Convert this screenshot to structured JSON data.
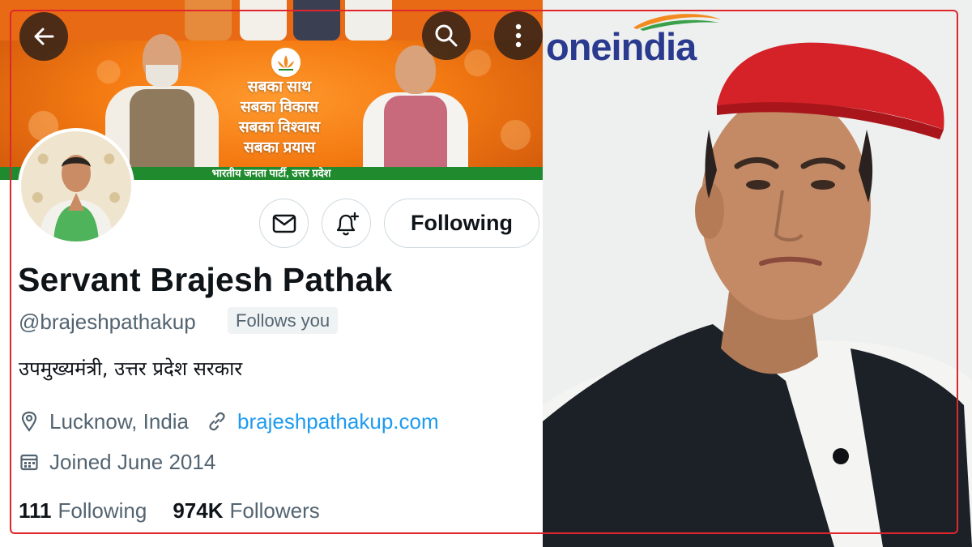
{
  "profile": {
    "banner": {
      "slogan": [
        "सबका साथ",
        "सबका विकास",
        "सबका विश्वास",
        "सबका प्रयास"
      ],
      "strip_text": "भारतीय जनता पार्टी, उत्तर प्रदेश"
    },
    "actions": {
      "following_label": "Following"
    },
    "name": "Servant Brajesh Pathak",
    "handle": "@brajeshpathakup",
    "follows_you": "Follows you",
    "bio": "उपमुख्यमंत्री, उत्तर प्रदेश सरकार",
    "location": "Lucknow, India",
    "website": "brajeshpathakup.com",
    "joined": "Joined June 2014",
    "stats": {
      "following_count": "111",
      "following_label": "Following",
      "followers_count": "974K",
      "followers_label": "Followers"
    },
    "icons": {
      "back": "arrow-left-icon",
      "search": "search-icon",
      "more": "more-vertical-icon",
      "message": "envelope-icon",
      "notify": "bell-plus-icon",
      "location": "location-pin-icon",
      "website": "link-icon",
      "joined": "calendar-icon"
    }
  },
  "brand": {
    "name": "oneindia"
  },
  "colors": {
    "frame": "#e0262d",
    "link": "#1d9bf0",
    "brand": "#2a3b8f",
    "banner_orange": "#f47a12",
    "banner_green": "#1f8a2e"
  }
}
